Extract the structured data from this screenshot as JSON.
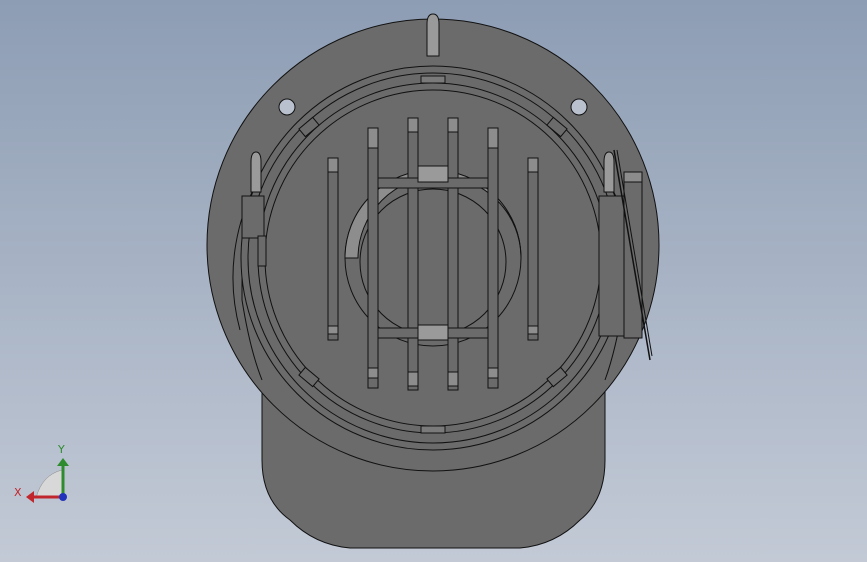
{
  "viewport": {
    "background_top": "#8d9db4",
    "background_bottom": "#c3cad6",
    "part_fill": "#6b6b6b",
    "part_fill_dark": "#5c5c5c",
    "part_fill_light": "#9a9a9a",
    "edge_color": "#111111"
  },
  "triad": {
    "x_label": "X",
    "y_label": "Y",
    "x_color": "#c0262c",
    "y_color": "#2e8b2e",
    "z_color": "#2233bb"
  }
}
